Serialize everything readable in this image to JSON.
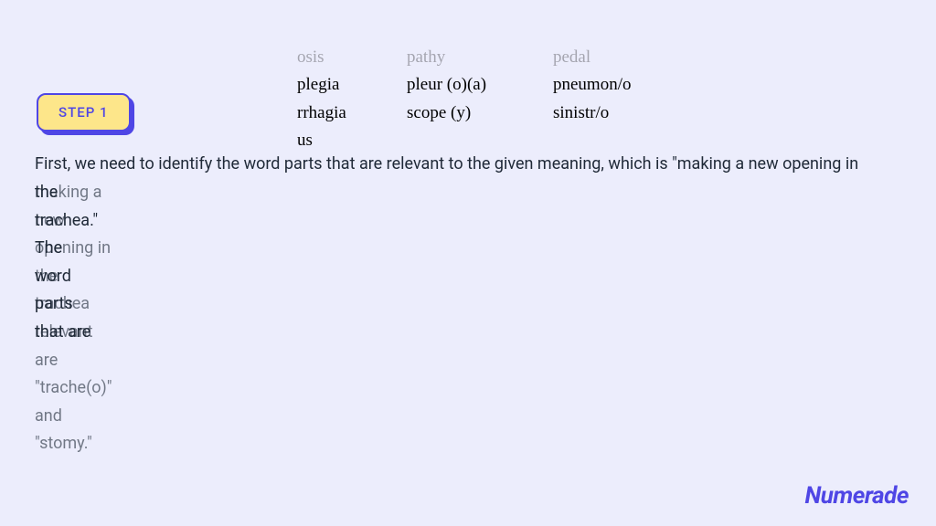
{
  "step_badge": "STEP 1",
  "words": {
    "row1": {
      "c1": "osis",
      "c2": "pathy",
      "c3": "pedal"
    },
    "row2": {
      "c1": "plegia",
      "c2": "pleur (o)(a)",
      "c3": "pneumon/o"
    },
    "row3": {
      "c1": "rrhagia",
      "c2": "scope (y)",
      "c3": "sinistr/o"
    },
    "row4": {
      "c1": "us",
      "c2": "",
      "c3": ""
    }
  },
  "explanation_line1": "First, we need to identify the word parts that are relevant to the given meaning, which is \"making a new opening in",
  "explanation_line2a": "the trachea.\" The word parts that are",
  "explanation_line2b": "making a new opening in the trachea relevant are \"trache(o)\" and \"stomy.\"",
  "brand": "Numerade"
}
